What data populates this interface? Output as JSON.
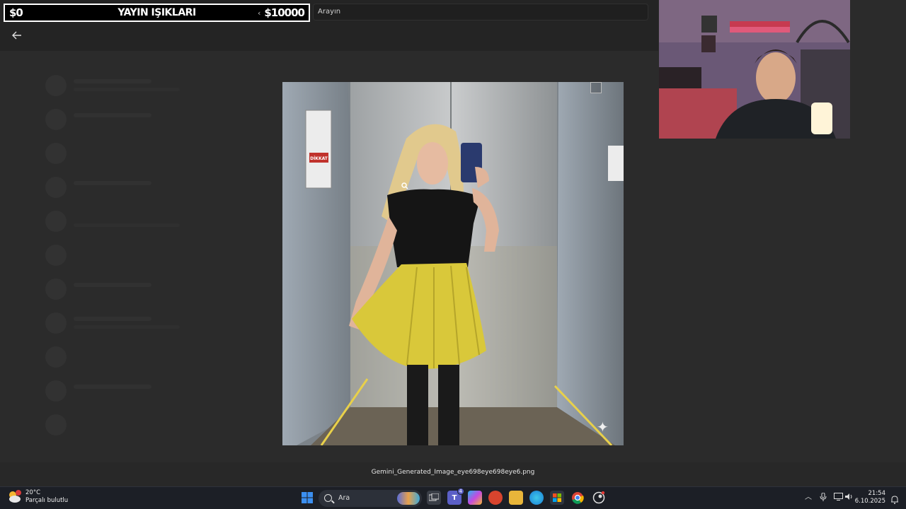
{
  "stream_goal": {
    "start": "$0",
    "title": "YAYIN IŞIKLARI",
    "end": "$10000"
  },
  "search": {
    "placeholder": "Arayın"
  },
  "viewer": {
    "file_name": "Gemini_Generated_Image_eye698eye698eye6.png",
    "sign_text": "DİKKAT"
  },
  "taskbar": {
    "weather": {
      "temp": "20°C",
      "condition": "Parçalı bulutlu"
    },
    "search_label": "Ara",
    "teams_badge": "4",
    "clock": {
      "time": "21:54",
      "date": "6.10.2025"
    }
  },
  "colors": {
    "accent_blue": "#3b8ff0",
    "skirt_yellow": "#d9c83a",
    "taskbar_bg": "#1c1f26"
  },
  "icons": [
    "back-arrow-icon",
    "windows-start-icon",
    "task-view-icon",
    "teams-icon",
    "copilot-icon",
    "app-icon",
    "file-explorer-icon",
    "edge-icon",
    "store-icon",
    "chrome-icon",
    "steam-icon",
    "chevron-up-icon",
    "microphone-icon",
    "network-icon",
    "volume-icon",
    "notification-icon",
    "sparkle-icon"
  ]
}
